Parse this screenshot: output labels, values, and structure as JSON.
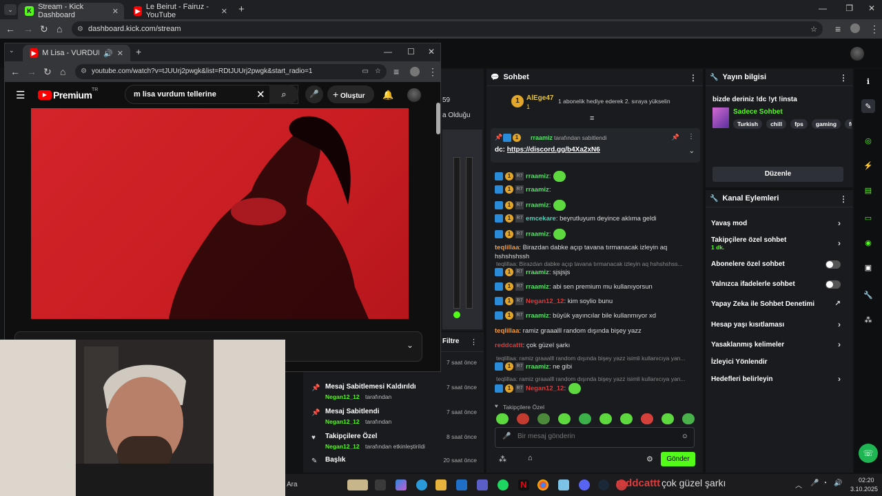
{
  "outer_browser": {
    "tabs": [
      {
        "title": "Stream - Kick Dashboard",
        "active": true
      },
      {
        "title": "Le Beirut - Fairuz - YouTube",
        "active": false
      }
    ],
    "url": "dashboard.kick.com/stream"
  },
  "center_partial": {
    "number": "59",
    "line": "a Olduğu"
  },
  "chat": {
    "title": "Sohbet",
    "top_gifter_name": "AlEge47",
    "top_gifter_count": "1",
    "gift_message": "1 abonelik hediye ederek 2. sıraya yükselin",
    "pinned_by": "rraamiz",
    "pinned_suffix": "tarafından sabitlendi",
    "pinned_text": "dc: ",
    "pinned_link": "https://discord.gg/b4Xa2xN6",
    "messages": [
      {
        "user": "rraamiz",
        "text": ":",
        "emote": true
      },
      {
        "user": "rraamiz",
        "text": ":",
        "emote": false
      },
      {
        "user": "rraamiz",
        "text": ":",
        "emote": true
      },
      {
        "user": "emcekare",
        "text": ": beyrutluyum deyince aklıma geldi",
        "emote": false
      },
      {
        "user": "rraamiz",
        "text": ":",
        "emote": true
      },
      {
        "user": "teqlillaa",
        "text": ": Birazdan dabke açıp tavana tırmanacak izleyin aq hshshshssh",
        "emote": false
      },
      {
        "user": "rraamiz",
        "text": ": sjsjsjs",
        "emote": false
      },
      {
        "user": "rraamiz",
        "text": ": abi sen premium mu kullanıyorsun",
        "emote": false
      },
      {
        "user": "Negan12_12",
        "text": ": kim soylio bunu",
        "emote": false
      },
      {
        "user": "rraamiz",
        "text": ": büyük yayıncılar bile kullanmıyor xd",
        "emote": false
      },
      {
        "user": "teqlillaa",
        "text": ": ramiz graaalll random dışında bişey yazz",
        "emote": false
      },
      {
        "user": "reddcattt",
        "text": ": çok güzel şarkı",
        "emote": false
      },
      {
        "user": "rraamiz",
        "text": ": ne gibi",
        "emote": false
      },
      {
        "user": "Negan12_12",
        "text": ":",
        "emote": true
      }
    ],
    "reply_1": "teqlillaa: Birazdan dabke açıp tavana tırmanacak izleyin aq hshshshss...",
    "reply_2": "teqlillaa: ramiz graaalll random dışında bişey yazz isimli kullanıcıya yan...",
    "reply_3": "teqlillaa: ramiz graaalll random dışında bişey yazz isimli kullanıcıya yan...",
    "followers_only_label": "Takipçilere Özel",
    "input_placeholder": "Bir mesaj gönderin",
    "send_label": "Gönder"
  },
  "stream_info": {
    "title": "Yayın bilgisi",
    "stream_title": "bizde deriniz !dc !yt !insta",
    "category": "Sadece Sohbet",
    "tags": [
      "Turkish",
      "chill",
      "fps",
      "gaming",
      "fu"
    ],
    "edit_label": "Düzenle"
  },
  "channel_actions": {
    "title": "Kanal Eylemleri",
    "slow_mode": "Yavaş mod",
    "followers_only": "Takipçilere özel sohbet",
    "followers_only_sub": "1 dk.",
    "subscribers_only": "Abonelere özel sohbet",
    "emotes_only": "Yalnızca ifadelerle sohbet",
    "ai_moderation": "Yapay Zeka ile Sohbet Denetimi",
    "account_age": "Hesap yaşı kısıtlaması",
    "banned_words": "Yasaklanmış kelimeler",
    "redirect": "İzleyici Yönlendir",
    "goals": "Hedefleri belirleyin"
  },
  "events": {
    "filter_label": "Filtre",
    "items": [
      {
        "title": "",
        "by": "",
        "time": "7 saat önce"
      },
      {
        "title": "Mesaj Sabitlemesi Kaldırıldı",
        "by": "Negan12_12",
        "by_suffix": "tarafından",
        "time": "7 saat önce"
      },
      {
        "title": "Mesaj Sabitlendi",
        "by": "Negan12_12",
        "by_suffix": "tarafından",
        "time": "7 saat önce"
      },
      {
        "title": "Takipçilere Özel",
        "by": "Negan12_12",
        "by_suffix": "tarafından etkinleştirildi",
        "time": "8 saat önce"
      },
      {
        "title": "Başlık",
        "by": "",
        "time": "20 saat önce"
      }
    ]
  },
  "youtube": {
    "tab_title": "M Lisa - VURDUM TELLERİN",
    "url": "youtube.com/watch?v=tJUUrj2pwgk&list=RDtJUUrj2pwgk&start_radio=1",
    "logo": "Premium",
    "logo_sup": "TR",
    "search_value": "m lisa vurdum tellerine",
    "create_label": "Oluştur"
  },
  "taskbar": {
    "search": "Ara",
    "time": "02:20",
    "date": "3.10.2025",
    "overlay_user": "reddcattt",
    "overlay_text": "çok güzel şarkı"
  },
  "colors": {
    "kick_green": "#53fc18",
    "video_red": "#d3242a"
  }
}
